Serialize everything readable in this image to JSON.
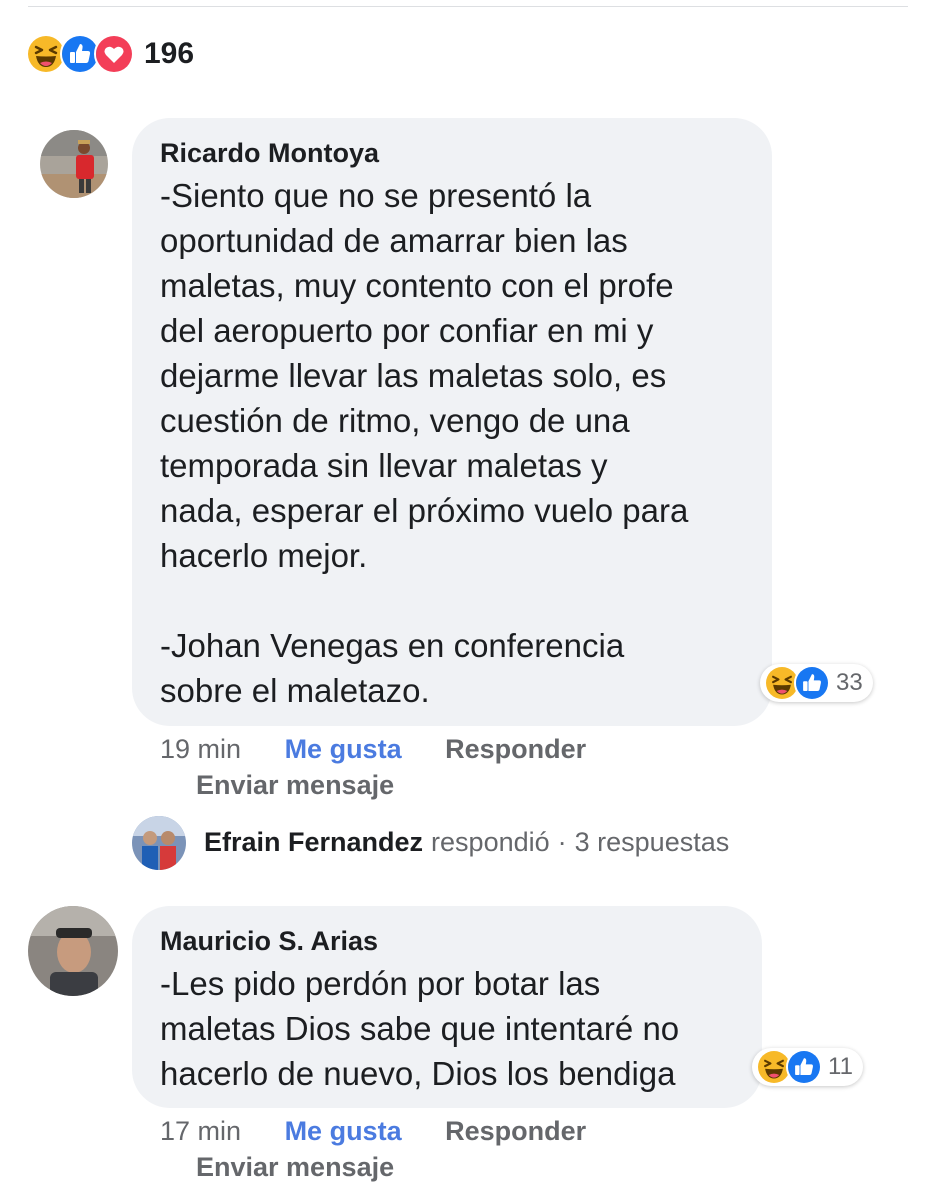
{
  "post": {
    "reaction_count": "196"
  },
  "comments": [
    {
      "author": "Ricardo Montoya",
      "text": "-Siento que no se presentó la\noportunidad de amarrar bien las\nmaletas, muy contento con el profe\ndel aeropuerto por confiar en mi y\ndejarme llevar las maletas solo, es\ncuestión de ritmo, vengo de una\ntemporada sin llevar maletas y\nnada, esperar el próximo vuelo para\nhacerlo mejor.\n\n-Johan Venegas en conferencia\nsobre el maletazo.",
      "reactions": "33",
      "time": "19 min",
      "like_label": "Me gusta",
      "reply_label": "Responder",
      "message_label": "Enviar mensaje",
      "reply_summary": {
        "name": "Efrain Fernandez",
        "action": "respondió",
        "separator": "·",
        "count": "3 respuestas"
      }
    },
    {
      "author": "Mauricio S. Arias",
      "text": "-Les pido perdón por botar las\nmaletas Dios sabe que intentaré no\nhacerlo de nuevo, Dios los bendiga",
      "reactions": "11",
      "time": "17 min",
      "like_label": "Me gusta",
      "reply_label": "Responder",
      "message_label": "Enviar mensaje"
    }
  ],
  "icons": {
    "haha": "haha-reaction-icon",
    "like": "like-reaction-icon",
    "love": "love-reaction-icon"
  },
  "colors": {
    "like_blue": "#1877f2",
    "love_red": "#f33e58",
    "haha_yellow": "#f7b928",
    "bubble_bg": "#f0f2f5",
    "meta_gray": "#65676b",
    "link_blue": "#4b7be0"
  }
}
